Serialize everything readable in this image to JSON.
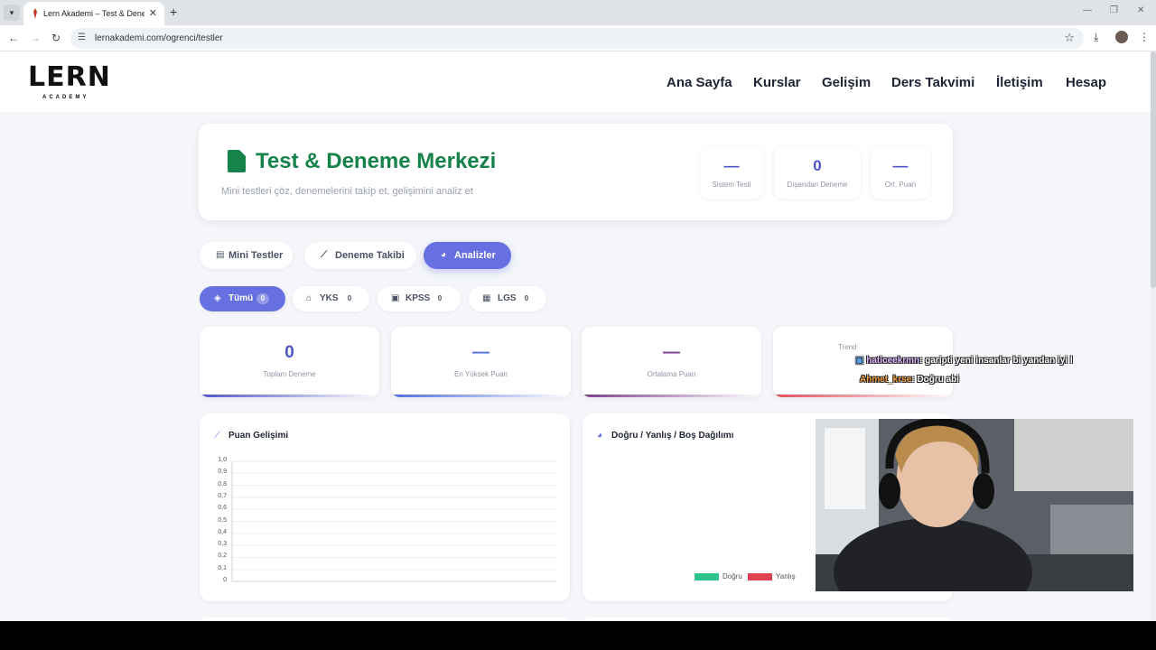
{
  "browser": {
    "tab_title": "Lern Akademi – Test & Deneme",
    "url": "lernakademi.com/ogrenci/testler"
  },
  "site": {
    "logo_main": "LERN",
    "logo_sub": "ACADEMY",
    "nav": [
      "Ana Sayfa",
      "Kurslar",
      "Gelişim",
      "Ders Takvimi",
      "İletişim",
      "Hesap"
    ]
  },
  "hero": {
    "title": "Test & Deneme Merkezi",
    "subtitle": "Mini testleri çöz, denemelerini takip et, gelişimini analiz et",
    "stats": [
      {
        "value": "—",
        "label": "Sistem Testi"
      },
      {
        "value": "0",
        "label": "Dışarıdan Deneme"
      },
      {
        "value": "—",
        "label": "Ort. Puan"
      }
    ]
  },
  "main_tabs": [
    "Mini Testler",
    "Deneme Takibi",
    "Analizler"
  ],
  "filters": [
    {
      "label": "Tümü",
      "count": "0"
    },
    {
      "label": "YKS",
      "count": "0"
    },
    {
      "label": "KPSS",
      "count": "0"
    },
    {
      "label": "LGS",
      "count": "0"
    }
  ],
  "stat_cards": [
    {
      "value": "0",
      "label": "Toplam Deneme",
      "color": "#4f54c8"
    },
    {
      "value": "—",
      "label": "En Yüksek Puan",
      "color": "#4f6ee0"
    },
    {
      "value": "—",
      "label": "Ortalama Puan",
      "color": "#7c3f8c"
    },
    {
      "value": "",
      "label": "Trend",
      "color": "#e04f5a"
    }
  ],
  "score_chart": {
    "title": "Puan Gelişimi",
    "y_ticks": [
      "1,0",
      "0,9",
      "0,8",
      "0,7",
      "0,6",
      "0,5",
      "0,4",
      "0,3",
      "0,2",
      "0,1",
      "0"
    ]
  },
  "chart_data": {
    "type": "line",
    "title": "Puan Gelişimi",
    "series": [],
    "ylim": [
      0,
      1
    ]
  },
  "distribution_chart": {
    "title": "Doğru / Yanlış / Boş Dağılımı",
    "legend": [
      {
        "label": "Doğru",
        "color": "#2bc48a"
      },
      {
        "label": "Yanlış",
        "color": "#e0404f"
      }
    ]
  },
  "stream_chat": [
    {
      "user": "haticeekrmn",
      "text": ": garipti yeni insanlar bi yandan iyi l"
    },
    {
      "user": "Ahmet_krse",
      "text": ": Doğru abi"
    }
  ]
}
